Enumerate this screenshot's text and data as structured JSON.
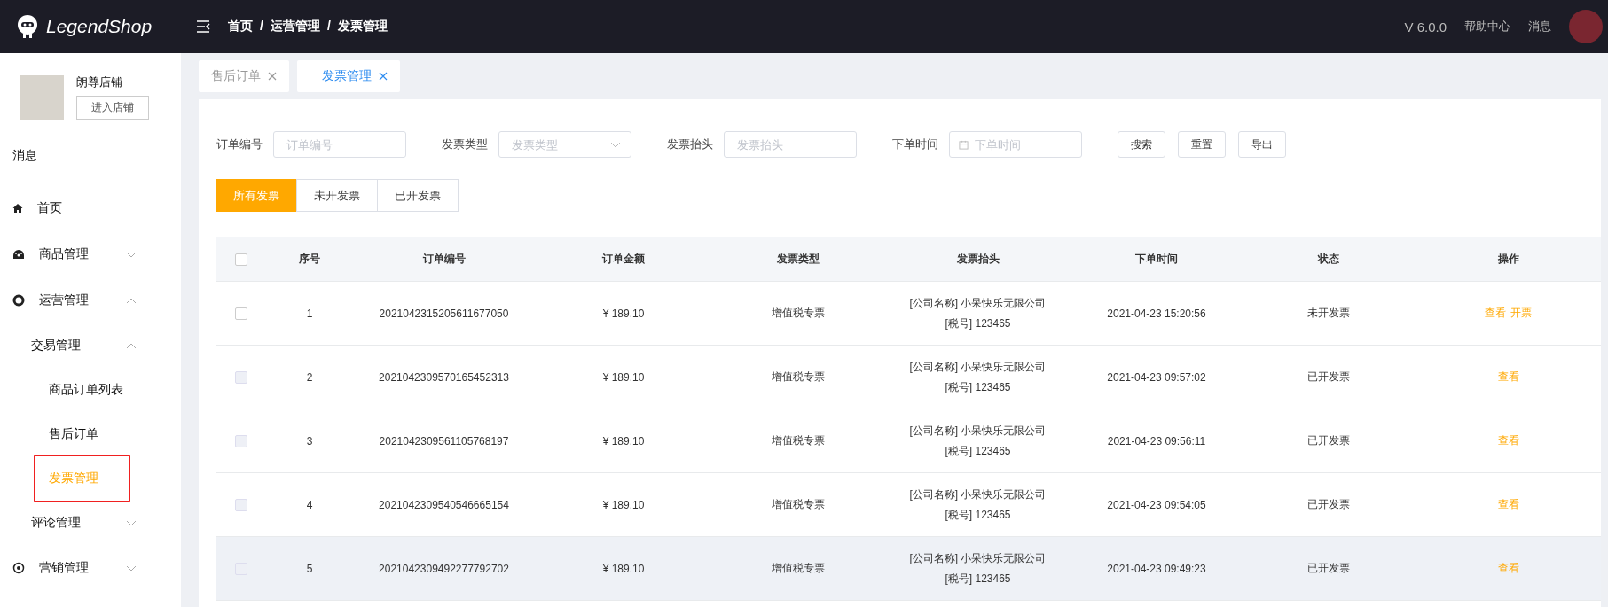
{
  "header": {
    "logo": "LegendShop",
    "breadcrumb": [
      "首页",
      "运营管理",
      "发票管理"
    ],
    "separator": "/",
    "version": "V 6.0.0",
    "links": [
      "帮助中心",
      "消息"
    ]
  },
  "shop": {
    "name": "朗尊店铺",
    "button": "进入店铺"
  },
  "sidebar": {
    "heading": "消息",
    "items": [
      {
        "label": "首页"
      },
      {
        "label": "商品管理",
        "expanded": false
      },
      {
        "label": "运营管理",
        "expanded": true,
        "children": [
          {
            "label": "交易管理",
            "expanded": true,
            "children": [
              {
                "label": "商品订单列表",
                "selected": false,
                "annotated": false
              },
              {
                "label": "售后订单",
                "selected": false,
                "annotated": false
              },
              {
                "label": "发票管理",
                "selected": true,
                "annotated": true
              }
            ]
          },
          {
            "label": "评论管理",
            "expanded": false
          }
        ]
      },
      {
        "label": "营销管理",
        "expanded": false
      }
    ]
  },
  "tabs": [
    {
      "label": "售后订单",
      "selected": false
    },
    {
      "label": "发票管理",
      "selected": true
    }
  ],
  "filters": [
    {
      "label": "订单编号",
      "placeholder": "订单编号",
      "kind": "text"
    },
    {
      "label": "发票类型",
      "placeholder": "发票类型",
      "kind": "select"
    },
    {
      "label": "发票抬头",
      "placeholder": "发票抬头",
      "kind": "text"
    },
    {
      "label": "下单时间",
      "placeholder": "下单时间",
      "kind": "date"
    }
  ],
  "buttons": [
    "搜索",
    "重置",
    "导出"
  ],
  "status_tabs": [
    {
      "label": "所有发票",
      "selected": true
    },
    {
      "label": "未开发票",
      "selected": false
    },
    {
      "label": "已开发票",
      "selected": false
    }
  ],
  "table": {
    "select_all_checked": false,
    "columns": [
      "序号",
      "订单编号",
      "订单金额",
      "发票类型",
      "发票抬头",
      "下单时间",
      "状态",
      "操作"
    ],
    "rows": [
      {
        "checked": false,
        "disabled": false,
        "highlighted": false,
        "index": "1",
        "order_no": "2021042315205611677050",
        "amount": "¥ 189.10",
        "type": "增值税专票",
        "title": [
          "[公司名称] 小呆快乐无限公司",
          "[税号] 123465"
        ],
        "time": "2021-04-23 15:20:56",
        "status": "未开发票",
        "actions": [
          "查看",
          "开票"
        ]
      },
      {
        "checked": false,
        "disabled": true,
        "highlighted": false,
        "index": "2",
        "order_no": "2021042309570165452313",
        "amount": "¥ 189.10",
        "type": "增值税专票",
        "title": [
          "[公司名称] 小呆快乐无限公司",
          "[税号] 123465"
        ],
        "time": "2021-04-23 09:57:02",
        "status": "已开发票",
        "actions": [
          "查看"
        ]
      },
      {
        "checked": false,
        "disabled": true,
        "highlighted": false,
        "index": "3",
        "order_no": "2021042309561105768197",
        "amount": "¥ 189.10",
        "type": "增值税专票",
        "title": [
          "[公司名称] 小呆快乐无限公司",
          "[税号] 123465"
        ],
        "time": "2021-04-23 09:56:11",
        "status": "已开发票",
        "actions": [
          "查看"
        ]
      },
      {
        "checked": false,
        "disabled": true,
        "highlighted": false,
        "index": "4",
        "order_no": "2021042309540546665154",
        "amount": "¥ 189.10",
        "type": "增值税专票",
        "title": [
          "[公司名称] 小呆快乐无限公司",
          "[税号] 123465"
        ],
        "time": "2021-04-23 09:54:05",
        "status": "已开发票",
        "actions": [
          "查看"
        ]
      },
      {
        "checked": false,
        "disabled": true,
        "highlighted": true,
        "index": "5",
        "order_no": "2021042309492277792702",
        "amount": "¥ 189.10",
        "type": "增值税专票",
        "title": [
          "[公司名称] 小呆快乐无限公司",
          "[税号] 123465"
        ],
        "time": "2021-04-23 09:49:23",
        "status": "已开发票",
        "actions": [
          "查看"
        ]
      }
    ]
  }
}
